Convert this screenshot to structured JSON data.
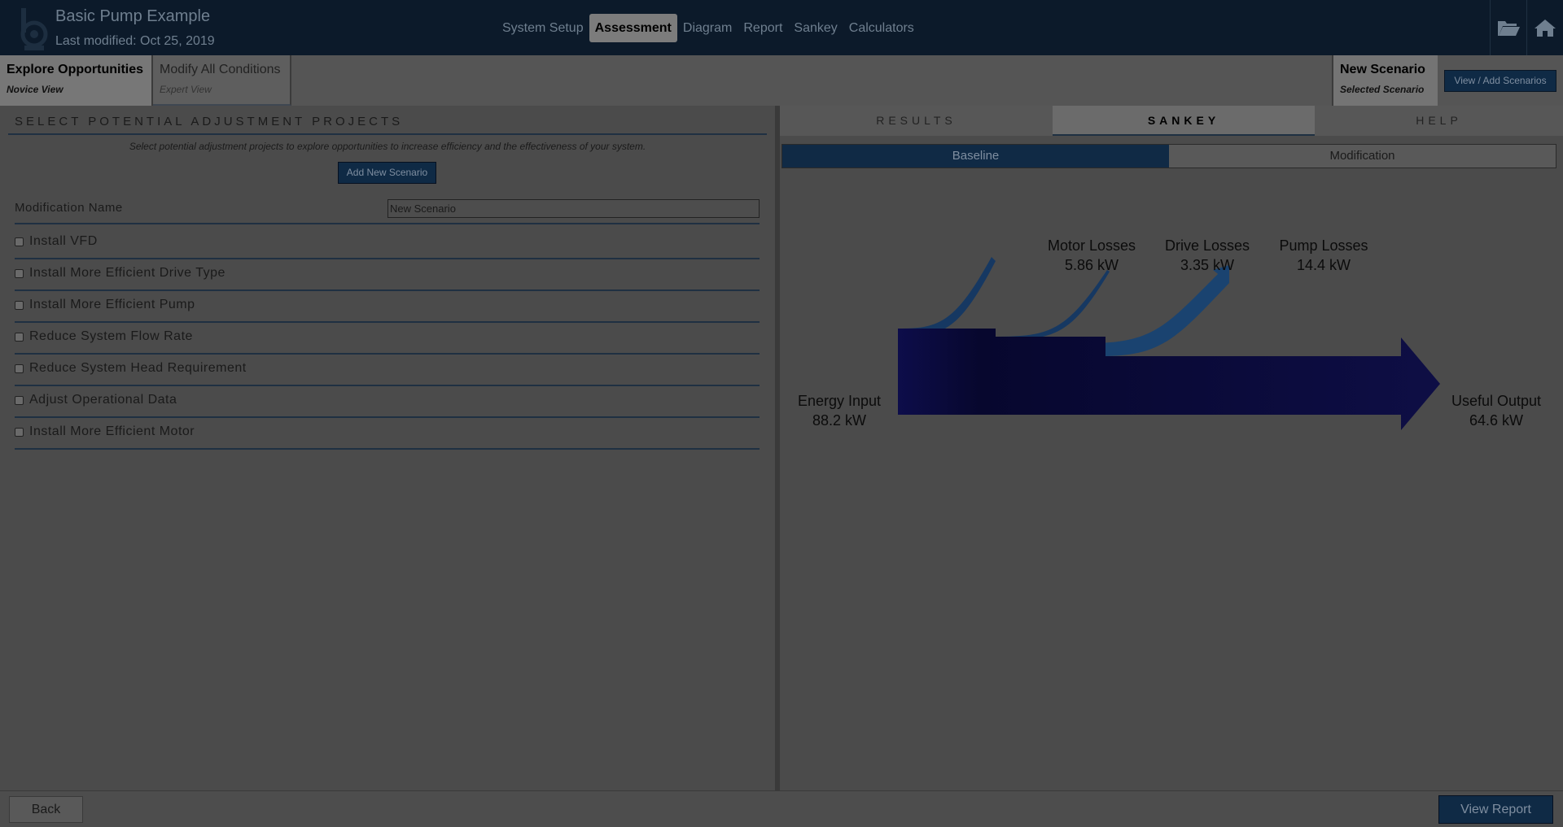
{
  "app": {
    "title": "Basic Pump Example",
    "last_modified": "Last modified: Oct 25, 2019"
  },
  "nav": {
    "items": [
      {
        "label": "System Setup",
        "active": false
      },
      {
        "label": "Assessment",
        "active": true
      },
      {
        "label": "Diagram",
        "active": false
      },
      {
        "label": "Report",
        "active": false
      },
      {
        "label": "Sankey",
        "active": false
      },
      {
        "label": "Calculators",
        "active": false
      }
    ],
    "icons": [
      "folder-open-icon",
      "home-icon"
    ]
  },
  "subheader": {
    "tabs": [
      {
        "title": "Explore Opportunities",
        "subtitle": "Novice View",
        "active": true
      },
      {
        "title": "Modify All Conditions",
        "subtitle": "Expert View",
        "active": false
      }
    ],
    "scenario": {
      "title": "New Scenario",
      "subtitle": "Selected Scenario"
    },
    "view_add_label": "View / Add Scenarios"
  },
  "left": {
    "section_title": "SELECT POTENTIAL ADJUSTMENT PROJECTS",
    "instructions": "Select potential adjustment projects to explore opportunities to increase efficiency and the effectiveness of your system.",
    "add_button": "Add New Scenario",
    "modification_label": "Modification Name",
    "modification_value": "New Scenario",
    "projects": [
      {
        "label": "Install VFD",
        "checked": false
      },
      {
        "label": "Install More Efficient Drive Type",
        "checked": false
      },
      {
        "label": "Install More Efficient Pump",
        "checked": false
      },
      {
        "label": "Reduce System Flow Rate",
        "checked": false
      },
      {
        "label": "Reduce System Head Requirement",
        "checked": false
      },
      {
        "label": "Adjust Operational Data",
        "checked": false
      },
      {
        "label": "Install More Efficient Motor",
        "checked": false
      }
    ]
  },
  "right": {
    "tabs": [
      {
        "label": "RESULTS",
        "active": false
      },
      {
        "label": "SANKEY",
        "active": true
      },
      {
        "label": "HELP",
        "active": false
      }
    ],
    "toggle": {
      "baseline": "Baseline",
      "modification": "Modification",
      "selected": "baseline"
    }
  },
  "sankey": {
    "input": {
      "name": "Energy Input",
      "value": "88.2 kW"
    },
    "losses": [
      {
        "name": "Motor Losses",
        "value": "5.86 kW"
      },
      {
        "name": "Drive Losses",
        "value": "3.35 kW"
      },
      {
        "name": "Pump Losses",
        "value": "14.4 kW"
      }
    ],
    "output": {
      "name": "Useful Output",
      "value": "64.6 kW"
    },
    "colors": {
      "main": "#0d0d45",
      "loss": "#1a3a63"
    }
  },
  "footer": {
    "back_label": "Back",
    "report_label": "View Report"
  }
}
